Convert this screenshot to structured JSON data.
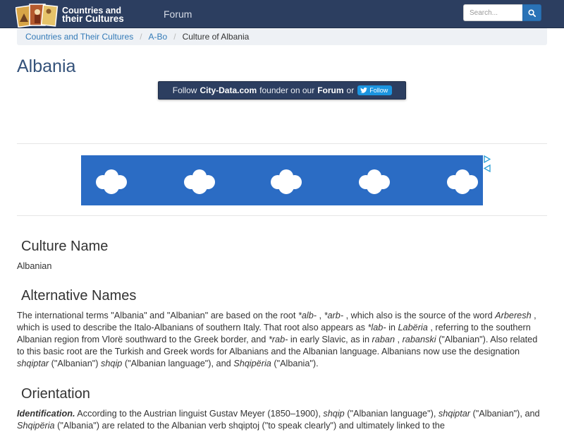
{
  "header": {
    "logo_line1": "Countries and",
    "logo_line2": "their Cultures",
    "nav_forum": "Forum",
    "search_placeholder": "Search..."
  },
  "breadcrumb": [
    "Countries and Their Cultures",
    "A-Bo",
    "Culture of Albania"
  ],
  "page_title": "Albania",
  "follow": {
    "pre": "Follow",
    "site": "City-Data.com",
    "mid": "founder on our",
    "forum": "Forum",
    "or": "or",
    "twitter_label": "Follow"
  },
  "sections": {
    "culture_name": {
      "heading": "Culture Name",
      "text": "Albanian"
    },
    "alternative_names": {
      "heading": "Alternative Names",
      "runs": [
        {
          "t": "The international terms \"Albania\" and \"Albanian\" are based on the root "
        },
        {
          "t": "*alb-",
          "i": true
        },
        {
          "t": " , "
        },
        {
          "t": "*arb-",
          "i": true
        },
        {
          "t": " , which also is the source of the word "
        },
        {
          "t": "Arberesh",
          "i": true
        },
        {
          "t": " , which is used to describe the Italo-Albanians of southern Italy. That root also appears as "
        },
        {
          "t": "*lab-",
          "i": true
        },
        {
          "t": " in "
        },
        {
          "t": "Labëria",
          "i": true
        },
        {
          "t": " , referring to the southern Albanian region from Vlorë southward to the Greek border, and "
        },
        {
          "t": "*rab-",
          "i": true
        },
        {
          "t": " in early Slavic, as in "
        },
        {
          "t": "raban",
          "i": true
        },
        {
          "t": " , "
        },
        {
          "t": "rabanski",
          "i": true
        },
        {
          "t": " (\"Albanian\"). Also related to this basic root are the Turkish and Greek words for Albanians and the Albanian language. Albanians now use the designation "
        },
        {
          "t": "shqiptar",
          "i": true
        },
        {
          "t": " (\"Albanian\") "
        },
        {
          "t": "shqip",
          "i": true
        },
        {
          "t": " (\"Albanian language\"), and "
        },
        {
          "t": "Shqipëria",
          "i": true
        },
        {
          "t": " (\"Albania\")."
        }
      ]
    },
    "orientation": {
      "heading": "Orientation",
      "label": "Identification.",
      "runs": [
        {
          "t": " According to the Austrian linguist Gustav Meyer (1850–1900), "
        },
        {
          "t": "shqip",
          "i": true
        },
        {
          "t": " (\"Albanian language\"), "
        },
        {
          "t": "shqiptar",
          "i": true
        },
        {
          "t": " (\"Albanian\"), and "
        },
        {
          "t": "Shqipëria",
          "i": true
        },
        {
          "t": " (\"Albania\") are related to the Albanian verb shqiptoj (\"to speak clearly\") and ultimately linked to the"
        }
      ]
    }
  },
  "colors": {
    "navbar": "#2c3e60",
    "link": "#337ab7",
    "title": "#34527a",
    "ad_bg": "#2b6cc4",
    "search_btn": "#2a73b7",
    "twitter": "#1b95e0"
  }
}
